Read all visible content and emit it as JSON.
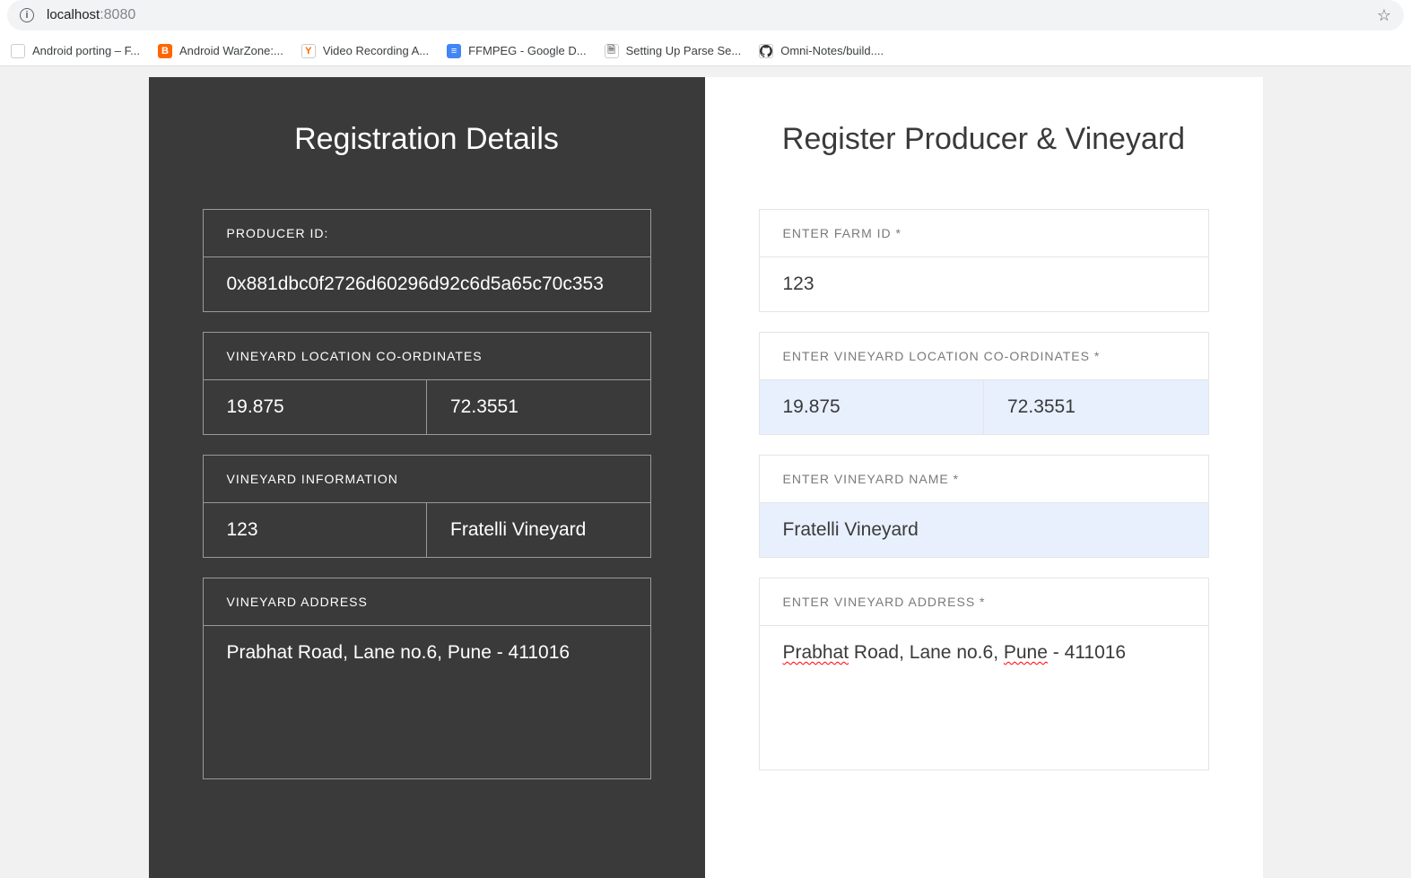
{
  "browser": {
    "url_host": "localhost",
    "url_port": ":8080"
  },
  "bookmarks": [
    {
      "label": "Android porting – F...",
      "iconBg": "#fff",
      "iconColor": "#888",
      "iconText": ""
    },
    {
      "label": "Android WarZone:...",
      "iconBg": "#ff6600",
      "iconColor": "#fff",
      "iconText": "B"
    },
    {
      "label": "Video Recording A...",
      "iconBg": "#fff",
      "iconColor": "#ff6600",
      "iconText": "Y"
    },
    {
      "label": "FFMPEG - Google D...",
      "iconBg": "#4285f4",
      "iconColor": "#fff",
      "iconText": "≡"
    },
    {
      "label": "Setting Up Parse Se...",
      "iconBg": "#fff",
      "iconColor": "#888",
      "iconText": "🗎"
    },
    {
      "label": "Omni-Notes/build....",
      "iconBg": "#fff",
      "iconColor": "#333",
      "iconText": ""
    }
  ],
  "left": {
    "title": "Registration Details",
    "producerIdLabel": "PRODUCER ID:",
    "producerId": "0x881dbc0f2726d60296d92c6d5a65c70c353",
    "coordLabel": "VINEYARD LOCATION CO-ORDINATES",
    "lat": "19.875",
    "lng": "72.3551",
    "infoLabel": "VINEYARD INFORMATION",
    "farmId": "123",
    "vineyardName": "Fratelli Vineyard",
    "addressLabel": "VINEYARD ADDRESS",
    "address": "Prabhat Road, Lane no.6, Pune - 411016"
  },
  "right": {
    "title": "Register Producer & Vineyard",
    "farmIdLabel": "ENTER FARM ID *",
    "farmId": "123",
    "coordLabel": "ENTER VINEYARD LOCATION CO-ORDINATES *",
    "lat": "19.875",
    "lng": "72.3551",
    "nameLabel": "ENTER VINEYARD NAME *",
    "name": "Fratelli Vineyard",
    "addressLabel": "ENTER VINEYARD ADDRESS *",
    "addressParts": [
      "Prabhat",
      " Road, Lane no.6, ",
      "Pune",
      " - 411016"
    ]
  }
}
